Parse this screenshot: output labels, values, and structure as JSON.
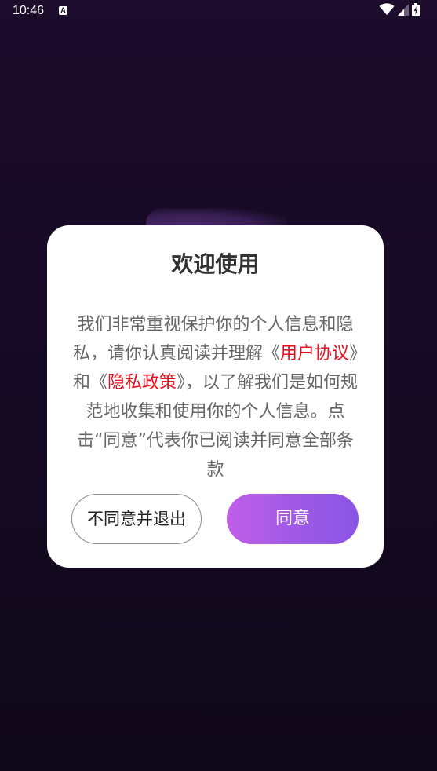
{
  "status_bar": {
    "time": "10:46",
    "notification_icon": "a-box-icon",
    "wifi_icon": "wifi-icon",
    "signal_icon": "signal-icon",
    "battery_icon": "battery-charging-icon"
  },
  "dialog": {
    "title": "欢迎使用",
    "body": {
      "text_before_user_agreement": "我们非常重视保护你的个人信息和隐私，请你认真阅读并理解《",
      "user_agreement_link": "用户协议",
      "text_between": "》和《",
      "privacy_policy_link": "隐私政策",
      "text_after": "》，以了解我们是如何规范地收集和使用你的个人信息。点击“同意”代表你已阅读并同意全部条款"
    },
    "decline_button_label": "不同意并退出",
    "agree_button_label": "同意"
  },
  "colors": {
    "background": "#1d0c2c",
    "link": "#e8101e",
    "agree_gradient_start": "#c05ee8",
    "agree_gradient_end": "#8a54e6",
    "title_text": "#333333",
    "body_text": "#666666"
  }
}
